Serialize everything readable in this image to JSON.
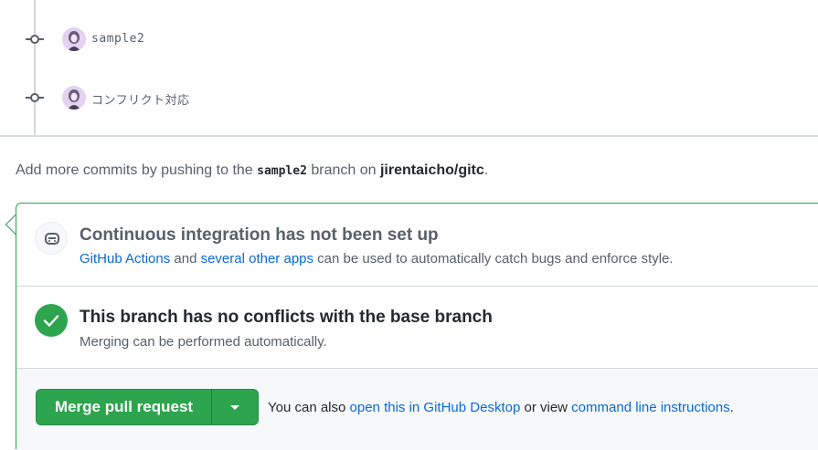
{
  "timeline": {
    "commits": [
      {
        "message": "sample2",
        "avatar_icon": "user-avatar"
      },
      {
        "message": "コンフリクト対応",
        "avatar_icon": "user-avatar"
      }
    ]
  },
  "push_hint": {
    "prefix": "Add more commits by pushing to the ",
    "branch": "sample2",
    "middle": " branch on ",
    "repo": "jirentaicho/gitc",
    "suffix": "."
  },
  "ci": {
    "icon": "ci-robot-icon",
    "title": "Continuous integration has not been set up",
    "link1": "GitHub Actions",
    "text1": " and ",
    "link2": "several other apps",
    "text2": " can be used to automatically catch bugs and enforce style."
  },
  "conflicts": {
    "icon": "check-icon",
    "title": "This branch has no conflicts with the base branch",
    "subtitle": "Merging can be performed automatically."
  },
  "merge": {
    "button_label": "Merge pull request",
    "text1": "You can also ",
    "link1": "open this in GitHub Desktop",
    "text2": " or view ",
    "link2": "command line instructions",
    "text3": "."
  },
  "colors": {
    "success": "#2da44e",
    "link": "#0969da",
    "muted": "#57606a"
  }
}
